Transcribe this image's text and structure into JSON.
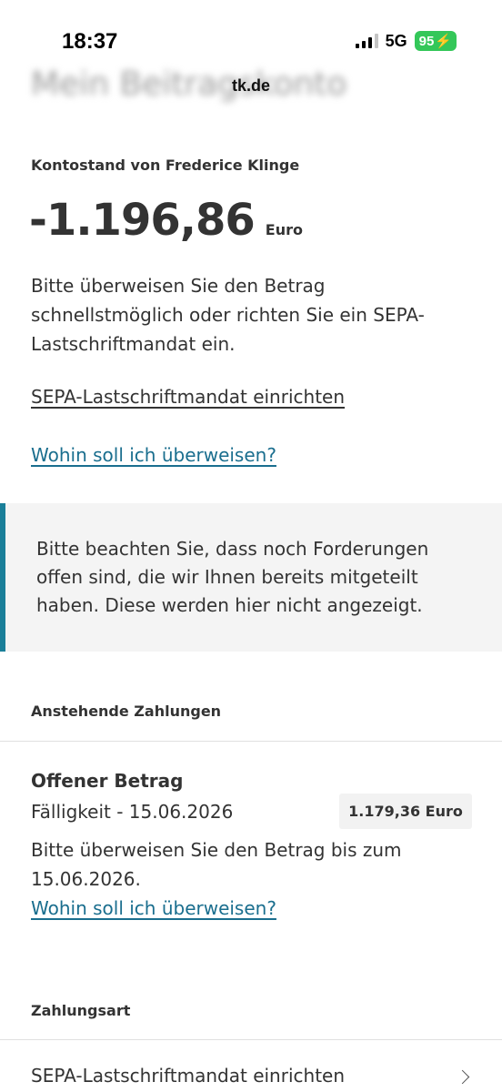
{
  "status_bar": {
    "time": "18:37",
    "network": "5G",
    "battery": "95",
    "icons": [
      "signal-icon",
      "battery-charging-icon"
    ]
  },
  "header": {
    "blurred_title": "Mein Beitragskonto",
    "url": "tk.de"
  },
  "account": {
    "owner_label": "Kontostand von Frederice Klinge",
    "balance": "-1.196,86",
    "currency": "Euro",
    "info": "Bitte überweisen Sie den Betrag schnellstmöglich oder richten Sie ein SEPA-Lastschriftmandat ein.",
    "sepa_link": "SEPA-Lastschriftmandat einrichten",
    "transfer_link": "Wohin soll ich überweisen?"
  },
  "notice": {
    "text": "Bitte beachten Sie, dass noch Forderungen offen sind, die wir Ihnen bereits mitgeteilt haben. Diese werden hier nicht angezeigt.",
    "accent_color": "#1a7f99"
  },
  "upcoming": {
    "heading": "Anstehende Zahlungen",
    "item": {
      "title": "Offener Betrag",
      "due": "Fälligkeit - 15.06.2026",
      "amount": "1.179,36 Euro",
      "description": "Bitte überweisen Sie den Betrag bis zum 15.06.2026.",
      "link": "Wohin soll ich überweisen?"
    }
  },
  "payment_method": {
    "heading": "Zahlungsart",
    "row_label": "SEPA-Lastschriftmandat einrichten",
    "row_icon": "chevron-right-icon"
  },
  "colors": {
    "link": "#1a6e8e",
    "text": "#333333",
    "battery": "#34c759"
  }
}
